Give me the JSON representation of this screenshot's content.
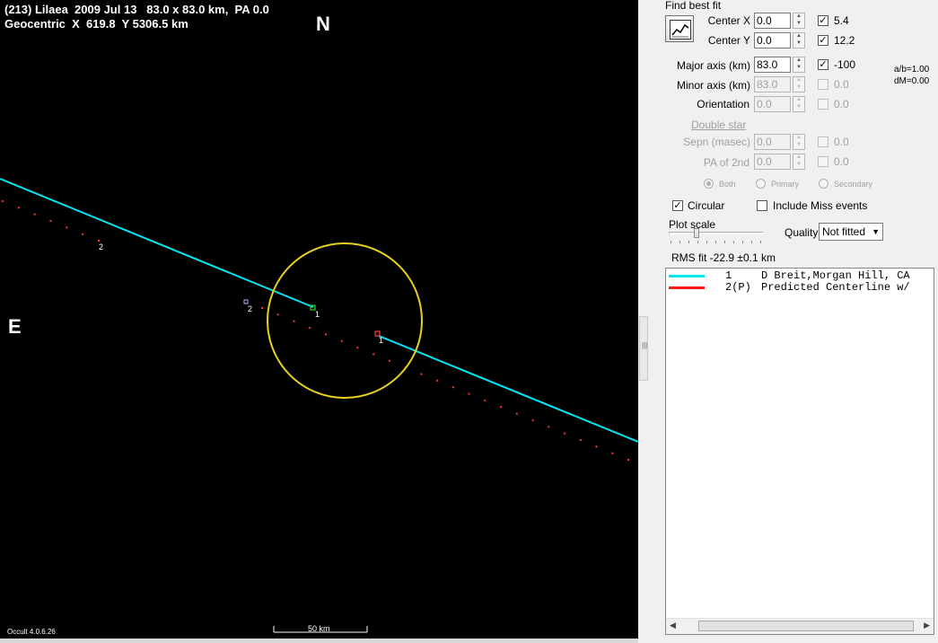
{
  "plot": {
    "title_line1": "(213) Lilaea  2009 Jul 13   83.0 x 83.0 km,  PA 0.0",
    "title_line2": "Geocentric  X  619.8  Y 5306.5 km",
    "north": "N",
    "east": "E",
    "version": "Occult 4.0.6.26",
    "scale_label": "50 km",
    "chord_labels": [
      "2",
      "2",
      "1",
      "1"
    ],
    "colors": {
      "background": "#000000",
      "observed_chord": "#00e6f0",
      "predicted_track": "#ff3030",
      "outline": "#e6d21e"
    }
  },
  "panel": {
    "find_best_fit": "Find best fit",
    "center_x": {
      "label": "Center X",
      "value": "0.0",
      "checked": true,
      "result": "5.4"
    },
    "center_y": {
      "label": "Center Y",
      "value": "0.0",
      "checked": true,
      "result": "12.2"
    },
    "major_axis": {
      "label": "Major axis (km)",
      "value": "83.0",
      "checked": true,
      "result": "-100"
    },
    "minor_axis": {
      "label": "Minor axis (km)",
      "value": "83.0",
      "checked": false,
      "result": "0.0"
    },
    "orientation": {
      "label": "Orientation",
      "value": "0.0",
      "checked": false,
      "result": "0.0"
    },
    "ratio": "a/b=1.00",
    "dm": "dM=0.00",
    "double_star": "Double star",
    "sepn": {
      "label": "Sepn (masec)",
      "value": "0.0",
      "result": "0.0"
    },
    "pa2nd": {
      "label": "PA of 2nd",
      "value": "0.0",
      "result": "0.0"
    },
    "radios": [
      "Both",
      "Primary",
      "Secondary"
    ],
    "circular": {
      "label": "Circular",
      "checked": true
    },
    "include_miss": {
      "label": "Include Miss events",
      "checked": false
    },
    "plot_scale": "Plot scale",
    "quality_label": "Quality",
    "quality_value": "Not fitted",
    "rms": "RMS fit -22.9 ±0.1 km",
    "list": [
      {
        "id": "1",
        "text": "D Breit,Morgan Hill, CA",
        "color": "#00e6f0"
      },
      {
        "id": "2(P)",
        "text": "Predicted Centerline w/",
        "color": "#ff1a1a"
      }
    ]
  }
}
